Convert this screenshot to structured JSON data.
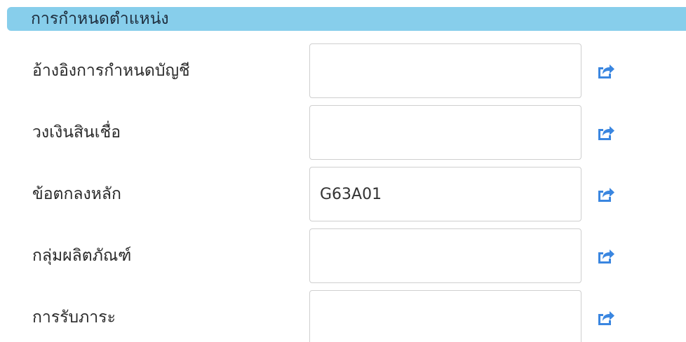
{
  "section": {
    "title": "การกำหนดตำแหน่ง"
  },
  "fields": [
    {
      "label": "อ้างอิงการกำหนดบัญชี",
      "value": "",
      "icon": "share-icon"
    },
    {
      "label": "วงเงินสินเชื่อ",
      "value": "",
      "icon": "share-icon"
    },
    {
      "label": "ข้อตกลงหลัก",
      "value": "G63A01",
      "icon": "share-icon"
    },
    {
      "label": "กลุ่มผลิตภัณฑ์",
      "value": "",
      "icon": "share-icon"
    },
    {
      "label": "การรับภาระ",
      "value": "",
      "icon": "share-icon"
    }
  ],
  "colors": {
    "header_bg": "#87ceeb",
    "icon_blue": "#3a86e0"
  }
}
